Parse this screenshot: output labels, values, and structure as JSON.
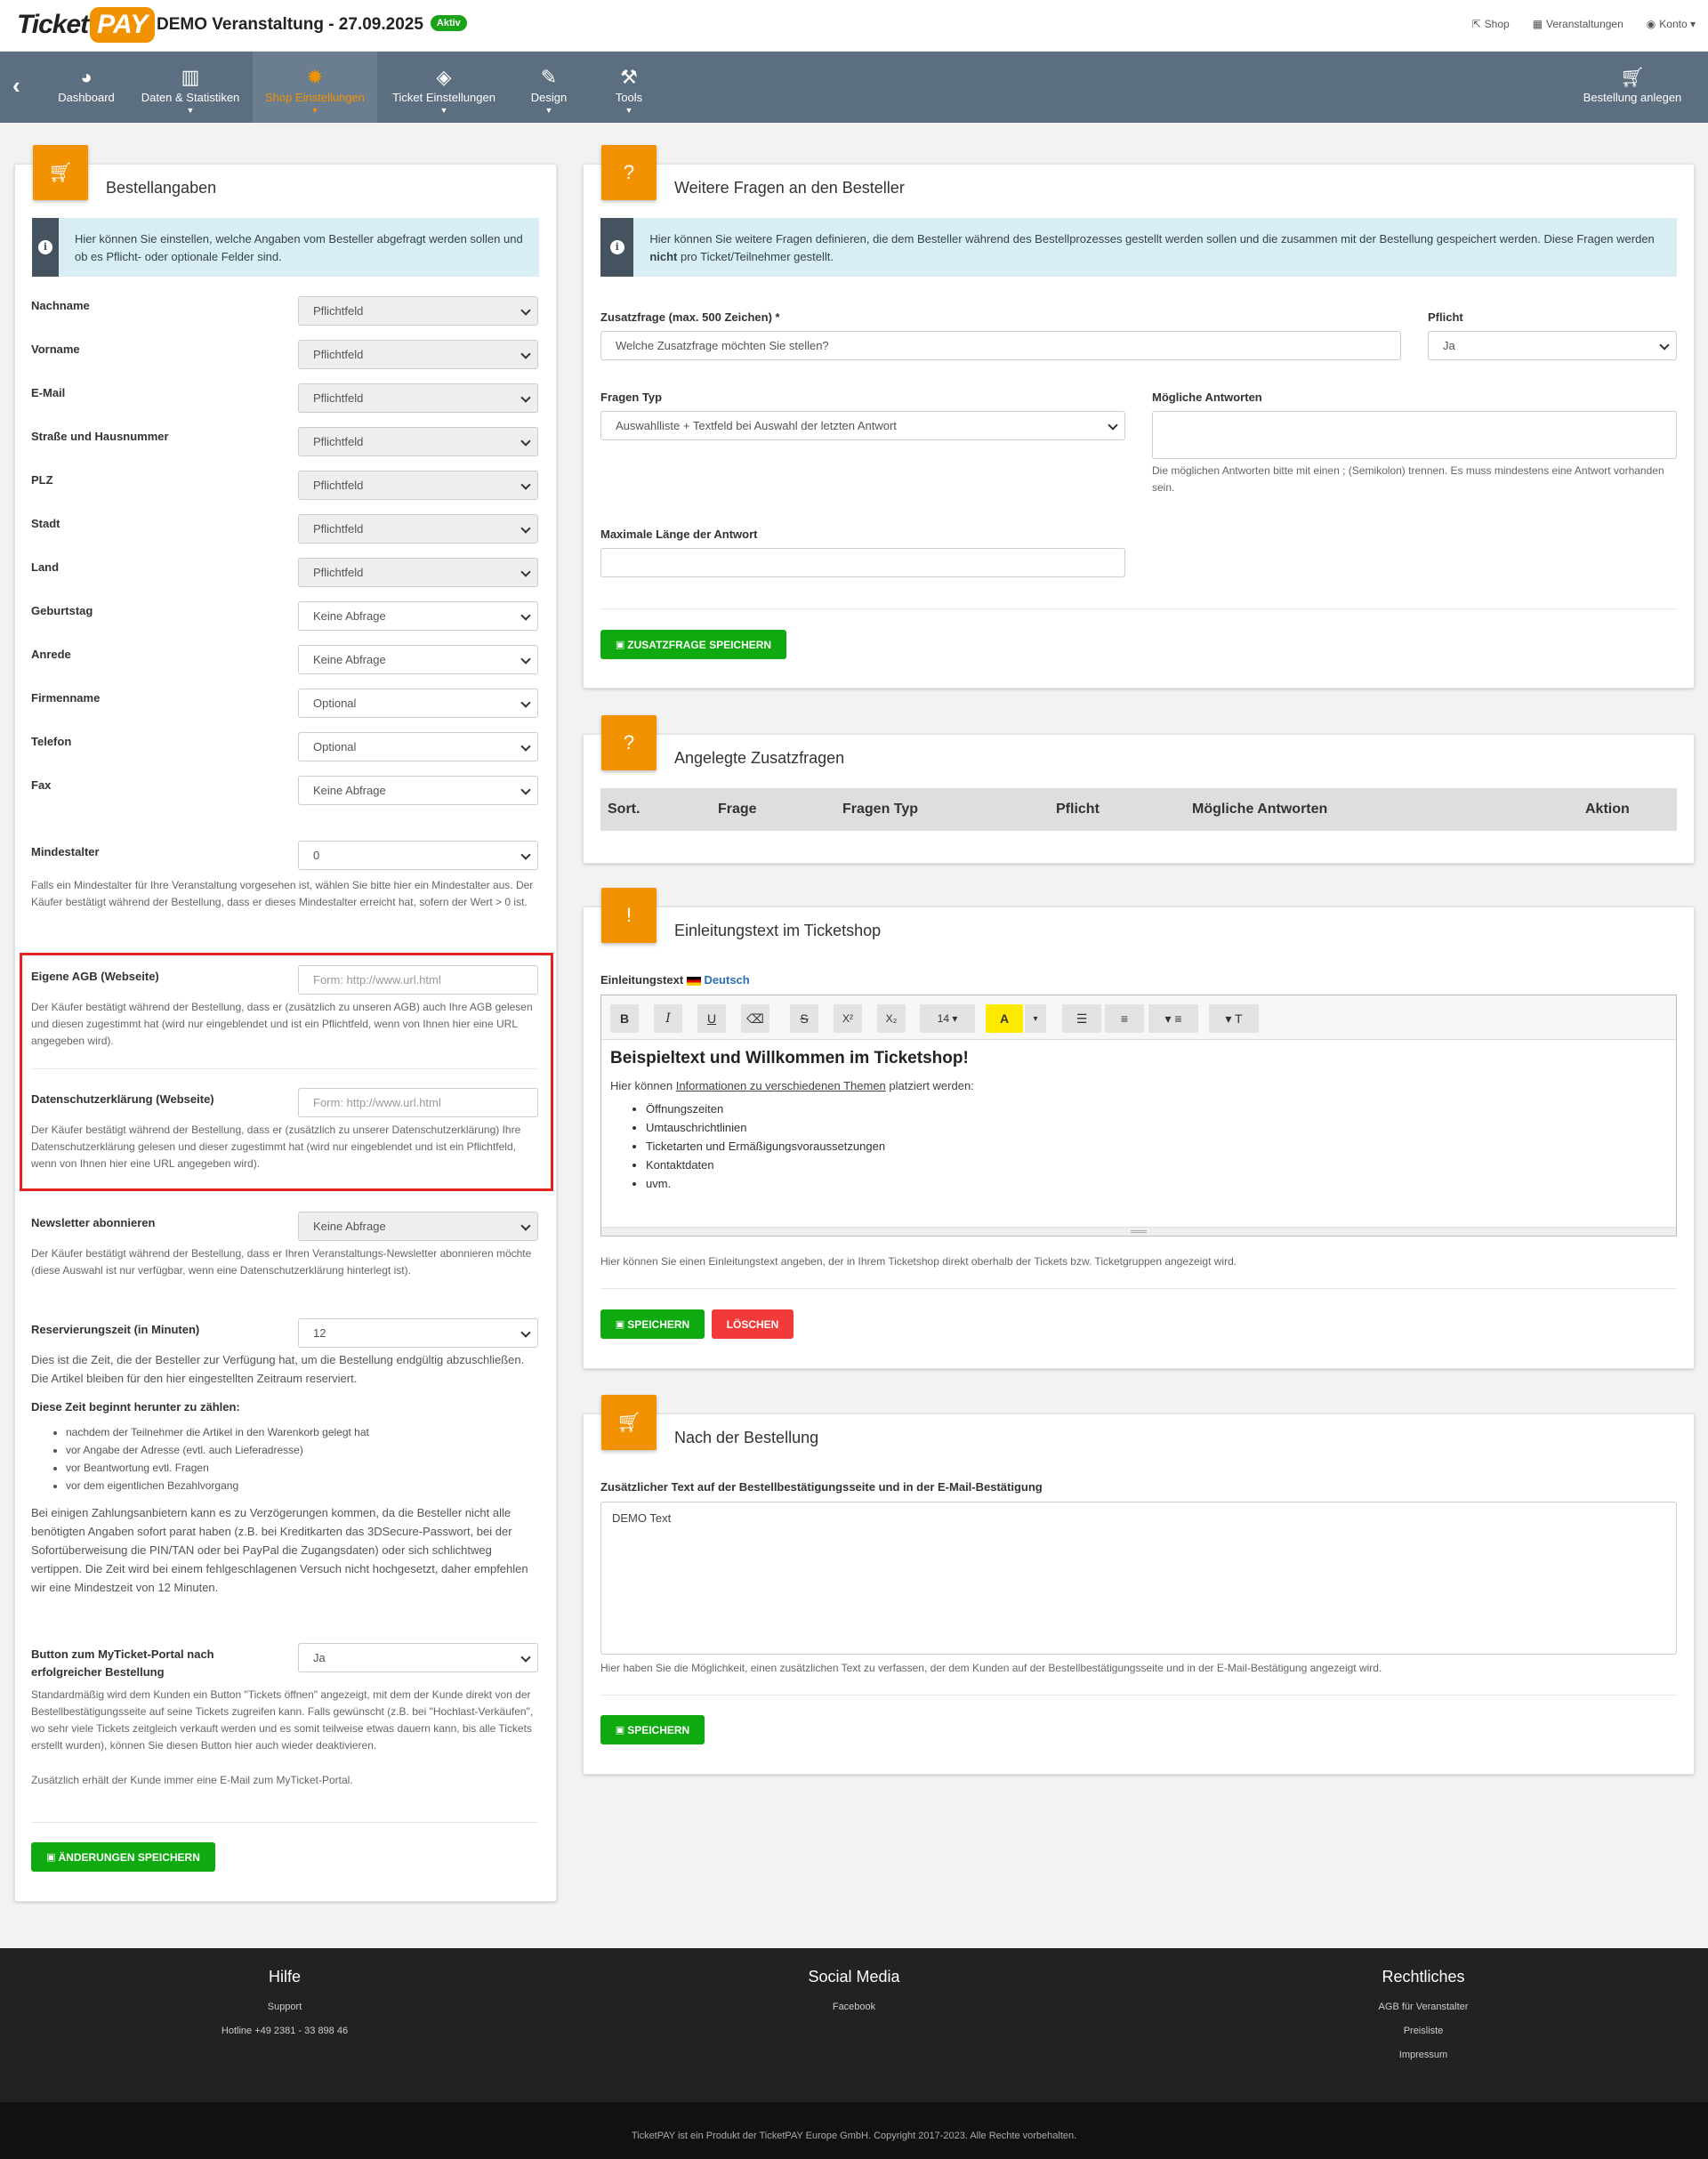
{
  "header": {
    "logo_ticket": "Ticket",
    "logo_pay": "PAY",
    "event_title": "DEMO Veranstaltung - 27.09.2025",
    "status_badge": "Aktiv",
    "links": {
      "shop": "Shop",
      "events": "Veranstaltungen",
      "account": "Konto"
    }
  },
  "nav": {
    "items": [
      {
        "label": "Dashboard",
        "icon": "dashboard-icon",
        "glyph": "◕"
      },
      {
        "label": "Daten & Statistiken",
        "icon": "bar-chart-icon",
        "glyph": "▥"
      },
      {
        "label": "Shop Einstellungen",
        "icon": "gear-icon",
        "glyph": "✹"
      },
      {
        "label": "Ticket Einstellungen",
        "icon": "ticket-icon",
        "glyph": "◈"
      },
      {
        "label": "Design",
        "icon": "brush-icon",
        "glyph": "✎"
      },
      {
        "label": "Tools",
        "icon": "wrench-icon",
        "glyph": "⚒"
      }
    ],
    "new_order": "Bestellung anlegen",
    "accent": "#f39200"
  },
  "bestellangaben": {
    "title": "Bestellangaben",
    "info": "Hier können Sie einstellen, welche Angaben vom Besteller abgefragt werden sollen und ob es Pflicht- oder optionale Felder sind.",
    "fields": [
      {
        "label": "Nachname",
        "value": "Pflichtfeld"
      },
      {
        "label": "Vorname",
        "value": "Pflichtfeld"
      },
      {
        "label": "E-Mail",
        "value": "Pflichtfeld"
      },
      {
        "label": "Straße und Hausnummer",
        "value": "Pflichtfeld"
      },
      {
        "label": "PLZ",
        "value": "Pflichtfeld"
      },
      {
        "label": "Stadt",
        "value": "Pflichtfeld"
      },
      {
        "label": "Land",
        "value": "Pflichtfeld"
      },
      {
        "label": "Geburtstag",
        "value": "Keine Abfrage"
      },
      {
        "label": "Anrede",
        "value": "Keine Abfrage"
      },
      {
        "label": "Firmenname",
        "value": "Optional"
      },
      {
        "label": "Telefon",
        "value": "Optional"
      },
      {
        "label": "Fax",
        "value": "Keine Abfrage"
      }
    ],
    "mindestalter": {
      "label": "Mindestalter",
      "value": "0",
      "help": "Falls ein Mindestalter für Ihre Veranstaltung vorgesehen ist, wählen Sie bitte hier ein Mindestalter aus. Der Käufer bestätigt während der Bestellung, dass er dieses Mindestalter erreicht hat, sofern der Wert > 0 ist."
    },
    "agb": {
      "label": "Eigene AGB (Webseite)",
      "placeholder": "Form: http://www.url.html",
      "help": "Der Käufer bestätigt während der Bestellung, dass er (zusätzlich zu unseren AGB) auch Ihre AGB gelesen und diesen zugestimmt hat (wird nur eingeblendet und ist ein Pflichtfeld, wenn von Ihnen hier eine URL angegeben wird)."
    },
    "datenschutz": {
      "label": "Datenschutzerklärung (Webseite)",
      "placeholder": "Form: http://www.url.html",
      "help": "Der Käufer bestätigt während der Bestellung, dass er (zusätzlich zu unserer Datenschutzerklärung) Ihre Datenschutzerklärung gelesen und dieser zugestimmt hat (wird nur eingeblendet und ist ein Pflichtfeld, wenn von Ihnen hier eine URL angegeben wird)."
    },
    "newsletter": {
      "label": "Newsletter abonnieren",
      "value": "Keine Abfrage",
      "help": "Der Käufer bestätigt während der Bestellung, dass er Ihren Veranstaltungs-Newsletter abonnieren möchte (diese Auswahl ist nur verfügbar, wenn eine Datenschutzerklärung hinterlegt ist)."
    },
    "reservierung": {
      "label": "Reservierungszeit (in Minuten)",
      "value": "12",
      "help1": "Dies ist die Zeit, die der Besteller zur Verfügung hat, um die Bestellung endgültig abzuschließen. Die Artikel bleiben für den hier eingestellten Zeitraum reserviert.",
      "subhead": "Diese Zeit beginnt herunter zu zählen:",
      "bullets": [
        "nachdem der Teilnehmer die Artikel in den Warenkorb gelegt hat",
        "vor Angabe der Adresse (evtl. auch Lieferadresse)",
        "vor Beantwortung evtl. Fragen",
        "vor dem eigentlichen Bezahlvorgang"
      ],
      "help2": "Bei einigen Zahlungsanbietern kann es zu Verzögerungen kommen, da die Besteller nicht alle benötigten Angaben sofort parat haben (z.B. bei Kreditkarten das 3DSecure-Passwort, bei der Sofortüberweisung die PIN/TAN oder bei PayPal die Zugangsdaten) oder sich schlichtweg vertippen. Die Zeit wird bei einem fehlgeschlagenen Versuch nicht hochgesetzt, daher empfehlen wir eine Mindestzeit von 12 Minuten."
    },
    "myticket": {
      "label": "Button zum MyTicket-Portal nach erfolgreicher Bestellung",
      "value": "Ja",
      "help": "Standardmäßig wird dem Kunden ein Button \"Tickets öffnen\" angezeigt, mit dem der Kunde direkt von der Bestellbestätigungsseite auf seine Tickets zugreifen kann. Falls gewünscht (z.B. bei \"Hochlast-Verkäufen\", wo sehr viele Tickets zeitgleich verkauft werden und es somit teilweise etwas dauern kann, bis alle Tickets erstellt wurden), können Sie diesen Button hier auch wieder deaktivieren.",
      "help2": "Zusätzlich erhält der Kunde immer eine E-Mail zum MyTicket-Portal."
    },
    "save": "ÄNDERUNGEN SPEICHERN"
  },
  "fragen": {
    "title": "Weitere Fragen an den Besteller",
    "info_part1": "Hier können Sie weitere Fragen definieren, die dem Besteller während des Bestellprozesses gestellt werden sollen und die zusammen mit der Bestellung gespeichert werden. Diese Fragen werden ",
    "info_bold": "nicht",
    "info_part2": " pro Ticket/Teilnehmer gestellt.",
    "zusatz_label": "Zusatzfrage (max. 500 Zeichen) *",
    "zusatz_placeholder": "Welche Zusatzfrage möchten Sie stellen?",
    "pflicht_label": "Pflicht",
    "pflicht_value": "Ja",
    "typ_label": "Fragen Typ",
    "typ_value": "Auswahlliste + Textfeld bei Auswahl der letzten Antwort",
    "antworten_label": "Mögliche Antworten",
    "antworten_help": "Die möglichen Antworten bitte mit einen ; (Semikolon) trennen. Es muss mindestens eine Antwort vorhanden sein.",
    "maxlen_label": "Maximale Länge der Antwort",
    "save": "ZUSATZFRAGE SPEICHERN"
  },
  "angelegt": {
    "title": "Angelegte Zusatzfragen",
    "columns": [
      "Sort.",
      "Frage",
      "Fragen Typ",
      "Pflicht",
      "Mögliche Antworten",
      "Aktion"
    ]
  },
  "einleitung": {
    "title": "Einleitungstext im Ticketshop",
    "label": "Einleitungstext",
    "lang": "Deutsch",
    "toolbar": [
      "B",
      "I",
      "U",
      "⌫",
      "S",
      "X²",
      "X₂",
      "14 ▾",
      "A",
      "▾",
      "☰",
      "≡",
      "▾ ≡",
      "▾ T"
    ],
    "content_title": "Beispieltext und Willkommen im Ticketshop!",
    "content_intro_pre": "Hier können ",
    "content_intro_link": "Informationen zu verschiedenen Themen",
    "content_intro_post": " platziert werden:",
    "content_list": [
      "Öffnungszeiten",
      "Umtauschrichtlinien",
      "Ticketarten und Ermäßigungsvoraussetzungen",
      "Kontaktdaten",
      "uvm."
    ],
    "help": "Hier können Sie einen Einleitungstext angeben, der in Ihrem Ticketshop direkt oberhalb der Tickets bzw. Ticketgruppen angezeigt wird.",
    "save": "SPEICHERN",
    "delete": "LÖSCHEN"
  },
  "nachbestellung": {
    "title": "Nach der Bestellung",
    "label": "Zusätzlicher Text auf der Bestellbestätigungsseite und in der E-Mail-Bestätigung",
    "value": "DEMO Text",
    "help": "Hier haben Sie die Möglichkeit, einen zusätzlichen Text zu verfassen, der dem Kunden auf der Bestellbestätigungsseite und in der E-Mail-Bestätigung angezeigt wird.",
    "save": "SPEICHERN"
  },
  "footer": {
    "hilfe": {
      "title": "Hilfe",
      "links": [
        "Support",
        "Hotline +49 2381 - 33 898 46"
      ]
    },
    "social": {
      "title": "Social Media",
      "links": [
        "Facebook"
      ]
    },
    "recht": {
      "title": "Rechtliches",
      "links": [
        "AGB für Veranstalter",
        "Preisliste",
        "Impressum"
      ]
    },
    "copyright": "TicketPAY ist ein Produkt der TicketPAY Europe GmbH. Copyright 2017-2023. Alle Rechte vorbehalten."
  }
}
